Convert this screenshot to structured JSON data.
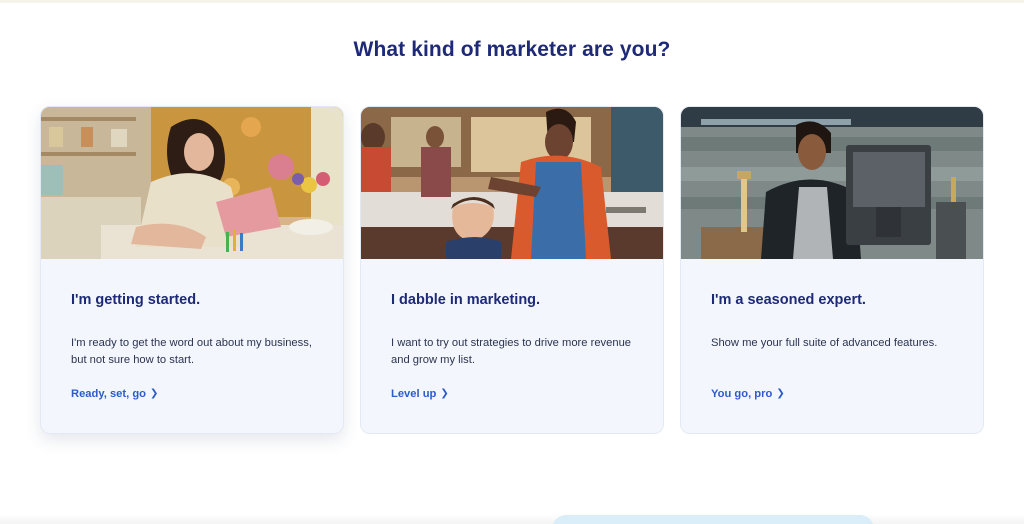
{
  "section": {
    "heading": "What kind of marketer are you?"
  },
  "cards": [
    {
      "title": "I'm getting started.",
      "description": "I'm ready to get the word out about my business, but not sure how to start.",
      "link_label": "Ready, set, go",
      "link_icon": "chevron-right-icon",
      "image": "woman-on-laptop-at-home-photo"
    },
    {
      "title": "I dabble in marketing.",
      "description": "I want to try out strategies to drive more revenue and grow my list.",
      "link_label": "Level up",
      "link_icon": "chevron-right-icon",
      "image": "barber-cutting-boy-hair-photo"
    },
    {
      "title": "I'm a seasoned expert.",
      "description": "Show me your full suite of advanced features.",
      "link_label": "You go, pro",
      "link_icon": "chevron-right-icon",
      "image": "woman-at-computer-in-shop-photo"
    }
  ],
  "colors": {
    "heading": "#1e2a78",
    "link": "#2d5cc8",
    "card_bg": "#f3f7fd",
    "body_text": "#2b3350"
  }
}
